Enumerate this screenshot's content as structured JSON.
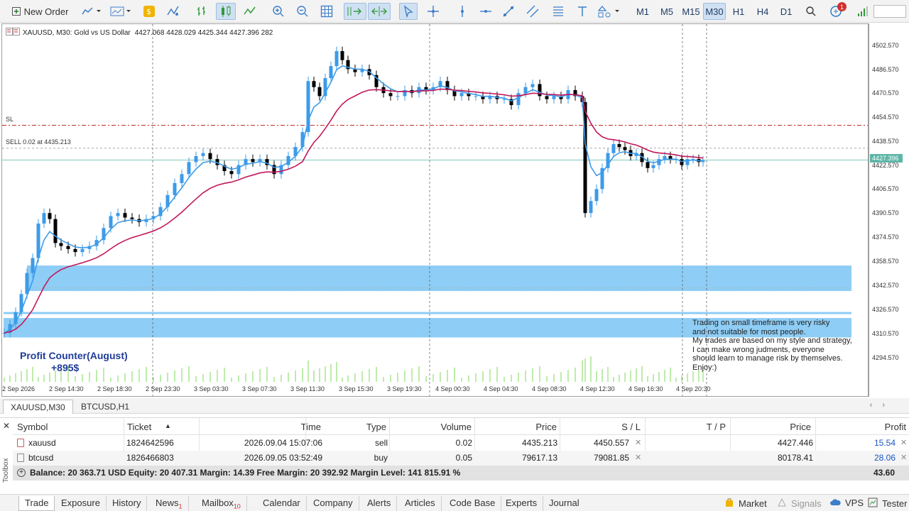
{
  "toolbar": {
    "new_order": "New Order",
    "timeframes": [
      "M1",
      "M5",
      "M15",
      "M30",
      "H1",
      "H4",
      "D1"
    ],
    "active_timeframe": "M30",
    "notification_count": "1",
    "icons": [
      "new-order-icon",
      "chart-type-icon",
      "templates-icon",
      "algo-trading-icon",
      "indicators-icon",
      "bar-chart-icon",
      "candlestick-icon",
      "line-chart-icon",
      "zoom-in-icon",
      "zoom-out-icon",
      "grid-icon",
      "autoscroll-icon",
      "chart-shift-icon",
      "cursor-icon",
      "crosshair-icon",
      "vertical-line-icon",
      "horizontal-line-icon",
      "trendline-icon",
      "channel-icon",
      "text-icon",
      "shapes-icon",
      "search-icon",
      "notifications-icon",
      "signal-strength-icon"
    ]
  },
  "chart": {
    "symbol_desc": "XAUUSD, M30:  Gold vs US Dollar",
    "ohlc": "4427.068 4428.029 4425.344 4427.396  282",
    "sl_label": "SL",
    "sell_label": "SELL 0.02 at 4435.213",
    "profit_title": "Profit Counter(August)",
    "profit_value": "+895$",
    "note_lines": [
      "Trading on small timeframe is very risky",
      "and not suitable for most people.",
      "My trades are based on my style and strategy,",
      "I can make wrong judments, everyone",
      "should learn to manage risk by themselves.",
      "Enjoy:)"
    ],
    "current_price": "4427.396",
    "price_labels": [
      "4502.570",
      "4486.570",
      "4470.570",
      "4454.570",
      "4438.570",
      "4422.570",
      "4406.570",
      "4390.570",
      "4374.570",
      "4358.570",
      "4342.570",
      "4326.570",
      "4310.570",
      "4294.570"
    ],
    "time_labels": [
      "2 Sep 2026",
      "2 Sep 14:30",
      "2 Sep 18:30",
      "2 Sep 23:30",
      "3 Sep 03:30",
      "3 Sep 07:30",
      "3 Sep 11:30",
      "3 Sep 15:30",
      "3 Sep 19:30",
      "4 Sep 00:30",
      "4 Sep 04:30",
      "4 Sep 08:30",
      "4 Sep 12:30",
      "4 Sep 16:30",
      "4 Sep 20:30"
    ],
    "colors": {
      "bull": "#3d9be9",
      "bear": "#000000",
      "ema_fast": "#3d9be9",
      "ema_slow": "#c2185b",
      "zone": "#8ecdf5",
      "sl": "#c62828",
      "price_line": "#5cb6a7"
    }
  },
  "chart_tabs": [
    "XAUUSD,M30",
    "BTCUSD,H1"
  ],
  "trade_table": {
    "headers": [
      "Symbol",
      "Ticket",
      "Time",
      "Type",
      "Volume",
      "Price",
      "S / L",
      "T / P",
      "Price",
      "Profit"
    ],
    "rows": [
      {
        "symbol": "xauusd",
        "ticket": "1824642596",
        "time": "2026.09.04 15:07:06",
        "type": "sell",
        "volume": "0.02",
        "price": "4435.213",
        "sl": "4450.557",
        "tp": "",
        "cur_price": "4427.446",
        "profit": "15.54"
      },
      {
        "symbol": "btcusd",
        "ticket": "1826466803",
        "time": "2026.09.05 03:52:49",
        "type": "buy",
        "volume": "0.05",
        "price": "79617.13",
        "sl": "79081.85",
        "tp": "",
        "cur_price": "80178.41",
        "profit": "28.06"
      }
    ],
    "balance_line": "Balance: 20 363.71 USD  Equity: 20 407.31  Margin: 14.39  Free Margin: 20 392.92  Margin Level: 141 815.91 %",
    "total_profit": "43.60"
  },
  "bottom_tabs": [
    {
      "label": "Trade",
      "badge": ""
    },
    {
      "label": "Exposure",
      "badge": ""
    },
    {
      "label": "History",
      "badge": ""
    },
    {
      "label": "News",
      "badge": "1"
    },
    {
      "label": "Mailbox",
      "badge": "10"
    },
    {
      "label": "Calendar",
      "badge": ""
    },
    {
      "label": "Company",
      "badge": ""
    },
    {
      "label": "Alerts",
      "badge": ""
    },
    {
      "label": "Articles",
      "badge": ""
    },
    {
      "label": "Code Base",
      "badge": ""
    },
    {
      "label": "Experts",
      "badge": ""
    },
    {
      "label": "Journal",
      "badge": ""
    }
  ],
  "status": {
    "toolbox": "Toolbox",
    "market": "Market",
    "signals": "Signals",
    "vps": "VPS",
    "tester": "Tester"
  }
}
